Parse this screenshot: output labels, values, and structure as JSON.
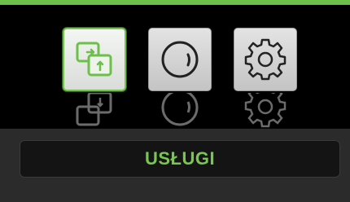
{
  "accent_color": "#6cc04a",
  "menu": {
    "items": [
      {
        "icon": "transfer-icon",
        "selected": true
      },
      {
        "icon": "knob-icon",
        "selected": false
      },
      {
        "icon": "gear-icon",
        "selected": false
      }
    ],
    "selected_label": "USŁUGI"
  }
}
